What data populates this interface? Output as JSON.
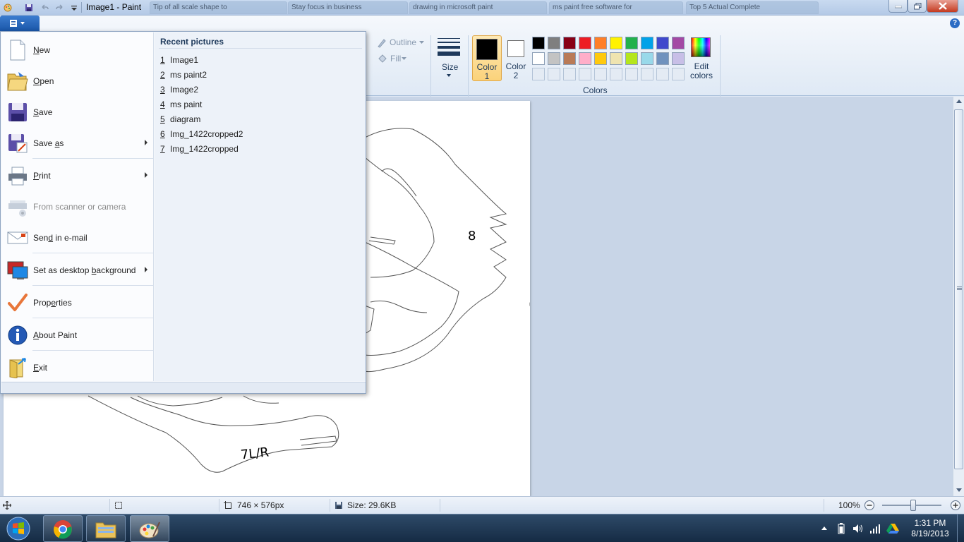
{
  "window": {
    "title": "Image1 - Paint",
    "background_tabs": [
      "Tip of all scale shape to",
      "Stay focus in business",
      "drawing in microsoft paint",
      "ms paint free software for",
      "Top 5 Actual Complete"
    ]
  },
  "ribbon": {
    "outline_label": "Outline",
    "fill_label": "Fill",
    "size_label": "Size",
    "color1_label": "Color 1",
    "color2_label": "Color 2",
    "colors_group_label": "Colors",
    "edit_colors_label": "Edit colors",
    "color1_value": "#000000",
    "color2_value": "#ffffff",
    "palette_row1": [
      "#000000",
      "#7f7f7f",
      "#880015",
      "#ed1c24",
      "#ff7f27",
      "#fff200",
      "#22b14c",
      "#00a2e8",
      "#3f48cc",
      "#a349a4"
    ],
    "palette_row2": [
      "#ffffff",
      "#c3c3c3",
      "#b97a57",
      "#ffaec9",
      "#ffc90e",
      "#efe4b0",
      "#b5e61d",
      "#99d9ea",
      "#7092be",
      "#c8bfe7"
    ]
  },
  "canvas": {
    "label_8": "8",
    "label_7lr": "7L/R"
  },
  "file_menu": {
    "items": [
      {
        "label": "New",
        "underline": "N",
        "rest": "ew",
        "icon": "new-document-icon"
      },
      {
        "label": "Open",
        "underline": "O",
        "rest": "pen",
        "icon": "open-folder-icon"
      },
      {
        "label": "Save",
        "underline": "S",
        "rest": "ave",
        "icon": "save-disk-icon"
      },
      {
        "label": "Save as",
        "pre": "Save ",
        "underline": "a",
        "rest": "s",
        "icon": "save-as-icon"
      },
      {
        "label": "Print",
        "underline": "P",
        "rest": "rint",
        "icon": "printer-icon"
      },
      {
        "label": "From scanner or camera",
        "icon": "scanner-icon"
      },
      {
        "label": "Send in e-mail",
        "pre": "Sen",
        "underline": "d",
        "rest": " in e-mail",
        "icon": "email-icon"
      },
      {
        "label": "Set as desktop background",
        "pre": "Set as desktop ",
        "underline": "b",
        "rest": "ackground",
        "icon": "desktop-icon"
      },
      {
        "label": "Properties",
        "pre": "Prop",
        "underline": "e",
        "rest": "rties",
        "icon": "checkmark-icon"
      },
      {
        "label": "About Paint",
        "pre": "",
        "underline": "A",
        "rest": "bout Paint",
        "icon": "info-icon"
      },
      {
        "label": "Exit",
        "underline": "E",
        "rest": "xit",
        "icon": "exit-icon"
      }
    ],
    "recent_title": "Recent pictures",
    "recent": [
      {
        "num": "1",
        "name": "Image1"
      },
      {
        "num": "2",
        "name": "ms paint2"
      },
      {
        "num": "3",
        "name": "Image2"
      },
      {
        "num": "4",
        "name": "ms paint"
      },
      {
        "num": "5",
        "name": "diagram"
      },
      {
        "num": "6",
        "name": "Img_1422cropped2"
      },
      {
        "num": "7",
        "name": "Img_1422cropped"
      }
    ]
  },
  "statusbar": {
    "dimensions": "746 × 576px",
    "size": "Size: 29.6KB",
    "zoom": "100%"
  },
  "taskbar": {
    "time": "1:31 PM",
    "date": "8/19/2013"
  }
}
